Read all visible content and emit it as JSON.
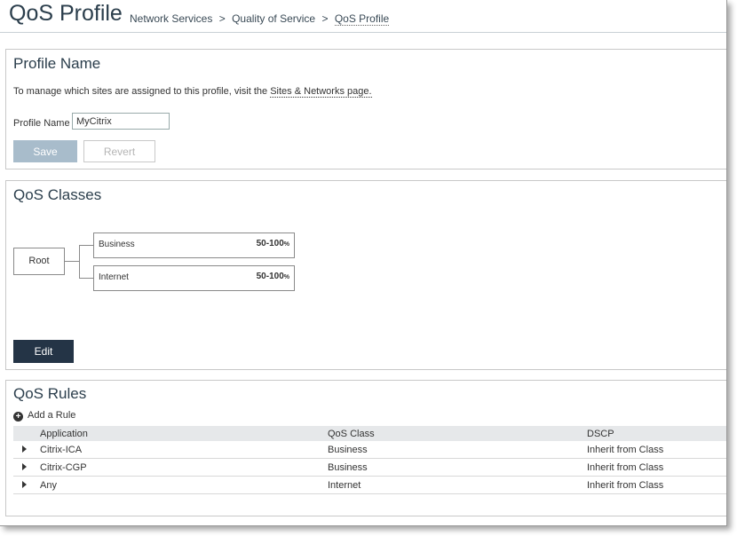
{
  "header": {
    "title": "QoS Profile",
    "breadcrumb": [
      "Network Services",
      "Quality of Service",
      "QoS Profile"
    ],
    "separator": ">"
  },
  "profile_name_panel": {
    "title": "Profile Name",
    "info_text": "To manage which sites are assigned to this profile, visit the",
    "info_link": "Sites & Networks page.",
    "field_label": "Profile Name",
    "field_value": "MyCitrix",
    "save_label": "Save",
    "revert_label": "Revert"
  },
  "qos_classes_panel": {
    "title": "QoS Classes",
    "root_label": "Root",
    "classes": [
      {
        "name": "Business",
        "range": "50-100",
        "unit": "%"
      },
      {
        "name": "Internet",
        "range": "50-100",
        "unit": "%"
      }
    ],
    "edit_label": "Edit"
  },
  "qos_rules_panel": {
    "title": "QoS Rules",
    "add_rule_label": "Add a Rule",
    "columns": [
      "Application",
      "QoS Class",
      "DSCP"
    ],
    "rows": [
      {
        "application": "Citrix-ICA",
        "qos_class": "Business",
        "dscp": "Inherit from Class"
      },
      {
        "application": "Citrix-CGP",
        "qos_class": "Business",
        "dscp": "Inherit from Class"
      },
      {
        "application": "Any",
        "qos_class": "Internet",
        "dscp": "Inherit from Class"
      }
    ]
  },
  "colors": {
    "edit_button": "#243446",
    "save_button_disabled": "#a8bccb",
    "title_text": "#2b3e4c"
  }
}
